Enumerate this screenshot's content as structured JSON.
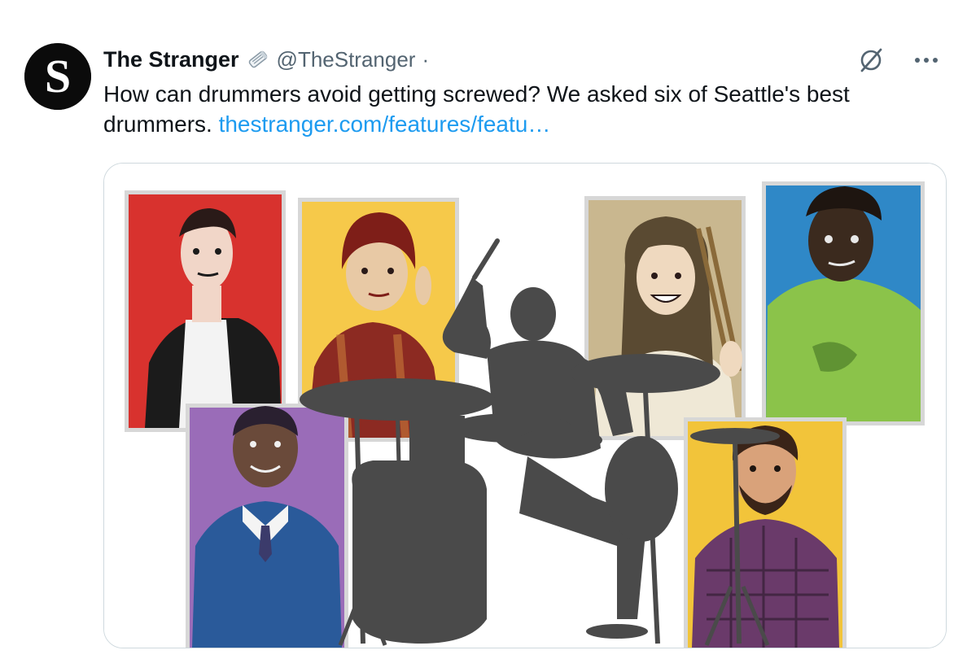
{
  "tweet": {
    "author_name": "The Stranger",
    "author_handle": "@TheStranger",
    "separator": "·",
    "avatar_letter": "S",
    "text": "How can drummers avoid getting screwed? We asked six of Seattle's best drummers. ",
    "link_text": "thestranger.com/features/featu…"
  },
  "icons": {
    "badge": "newspaper-icon",
    "grok": "grok-icon",
    "more": "more-icon"
  },
  "media": {
    "portrait_colors": [
      "#d8322e",
      "#f6c94a",
      "#c9b78f",
      "#2f88c7",
      "#9a6cb8",
      "#f2c43a"
    ],
    "silhouette_color": "#4a4a4a"
  },
  "colors": {
    "text": "#0f1419",
    "secondary": "#536471",
    "link": "#1d9bf0",
    "border": "#cfd9de"
  }
}
